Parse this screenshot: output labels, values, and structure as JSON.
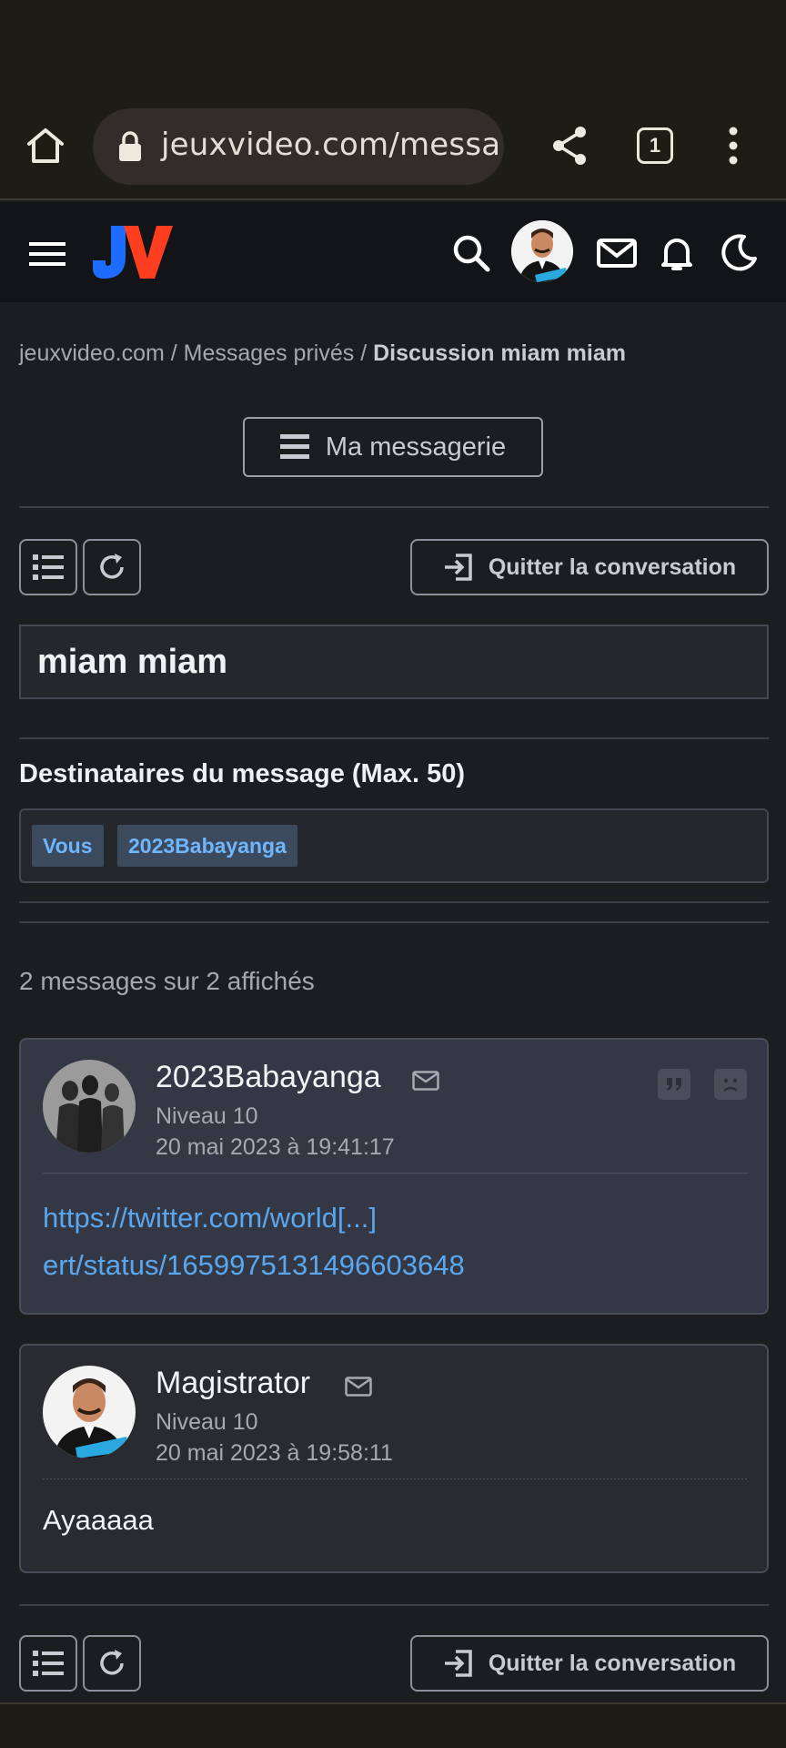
{
  "browser": {
    "url": "jeuxvideo.com/messa",
    "tab_count": "1",
    "icons": [
      "home-icon",
      "lock-icon",
      "share-icon",
      "tabs-icon",
      "more-vert-icon"
    ]
  },
  "header": {
    "logo_text": "JV",
    "icons": [
      "menu-icon",
      "search-icon",
      "avatar",
      "mail-icon",
      "bell-icon",
      "moon-icon"
    ]
  },
  "breadcrumb": {
    "items": [
      "jeuxvideo.com",
      "Messages privés",
      "Discussion miam miam"
    ],
    "separator": "/"
  },
  "messagerie_button": "Ma messagerie",
  "toolbar": {
    "quit_label": "Quitter la conversation"
  },
  "subject": "miam miam",
  "recipients": {
    "label": "Destinataires du message (Max. 50)",
    "tags": [
      "Vous",
      "2023Babayanga"
    ]
  },
  "messages_count": "2 messages sur 2 affichés",
  "posts": [
    {
      "author": "2023Babayanga",
      "level": "Niveau 10",
      "date": "20 mai 2023 à 19:41:17",
      "link_line1": "https://twitter.com/world[...]",
      "link_line2": "ert/status/1659975131496603648"
    },
    {
      "author": "Magistrator",
      "level": "Niveau 10",
      "date": "20 mai 2023 à 19:58:11",
      "text": "Ayaaaaa"
    }
  ],
  "colors": {
    "page_bg": "#1c1d21",
    "link": "#5aa7ef",
    "tag_text": "#6fb6ff",
    "logo_blue": "#1e6bff",
    "logo_red": "#ff3d1f"
  }
}
